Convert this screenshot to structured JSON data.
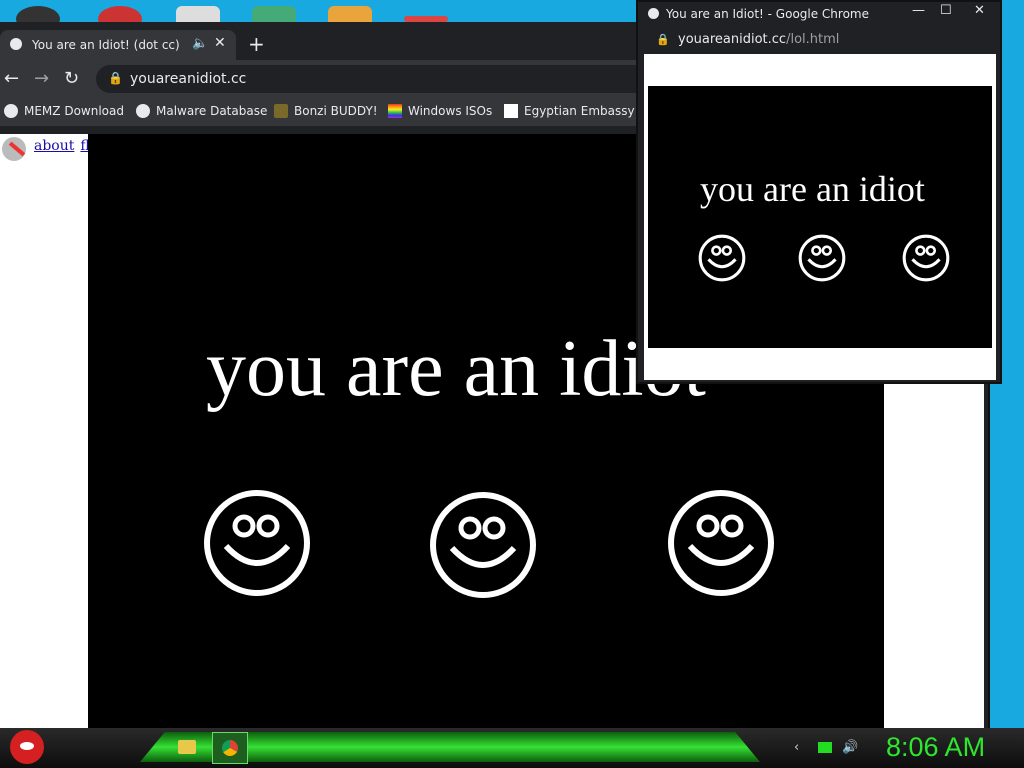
{
  "main_window": {
    "tab_title": "You are an Idiot! (dot cc)",
    "url": "youareanidiot.cc",
    "bookmarks": [
      "MEMZ Download",
      "Malware Database",
      "Bonzi BUDDY!",
      "Windows ISOs",
      "Egyptian Embassy"
    ],
    "page_links": [
      "about",
      "flash"
    ],
    "headline": "you are an idiot"
  },
  "popup_window": {
    "title": "You are an Idiot! - Google Chrome",
    "url_host": "youareanidiot.cc",
    "url_path": "/lol.html",
    "headline": "you are an idiot"
  },
  "taskbar": {
    "clock": "8:06 AM"
  },
  "colors": {
    "desktop": "#18a9e0",
    "clock": "#2ee62e",
    "taskbar_glow": "#35e035"
  },
  "icons": [
    "speaker-icon",
    "close-icon",
    "new-tab-icon",
    "back-icon",
    "forward-icon",
    "reload-icon",
    "lock-icon",
    "smiley-icon",
    "angry-bird-start-icon",
    "folder-icon",
    "chrome-icon",
    "volume-icon",
    "network-icon"
  ]
}
